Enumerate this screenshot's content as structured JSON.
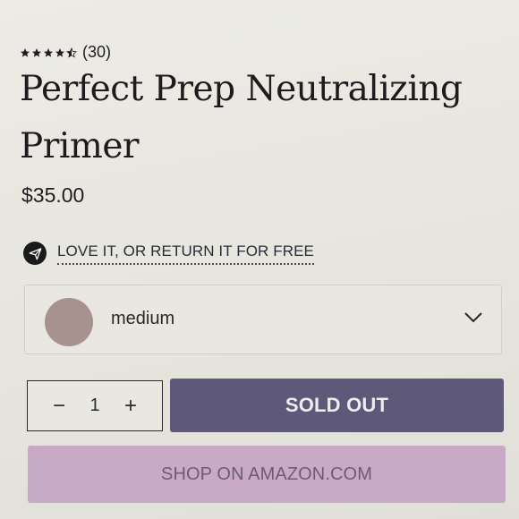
{
  "rating": {
    "stars_value": 4.5,
    "stars_max": 5,
    "count_text": "(30)"
  },
  "product": {
    "title": "Perfect Prep Neutralizing Primer",
    "price": "$35.00"
  },
  "guarantee": {
    "icon": "paper-plane-icon",
    "text": "LOVE IT, OR RETURN IT FOR FREE"
  },
  "shade": {
    "selected": "medium",
    "swatch_color": "#a89290",
    "icon": "chevron-down-icon"
  },
  "quantity": {
    "minus": "−",
    "value": "1",
    "plus": "+"
  },
  "buttons": {
    "sold_out": "SOLD OUT",
    "amazon": "SHOP ON AMAZON.COM"
  },
  "colors": {
    "sold_out_bg": "#5e5879",
    "amazon_bg": "#c9aac6",
    "amazon_text": "#6f5a75"
  }
}
